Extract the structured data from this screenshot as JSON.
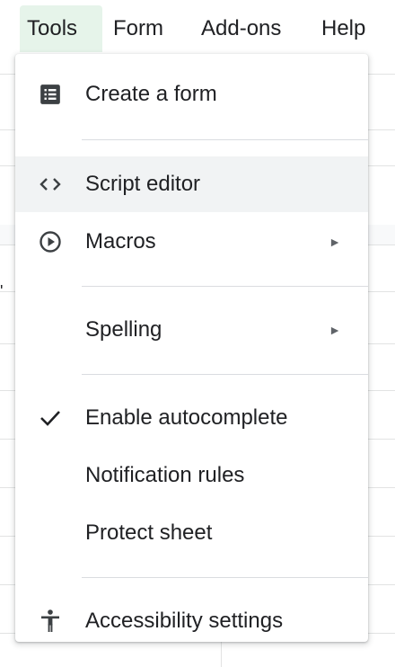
{
  "menubar": {
    "tabs": [
      {
        "label": "Tools",
        "active": true
      },
      {
        "label": "Form"
      },
      {
        "label": "Add-ons"
      },
      {
        "label": "Help"
      }
    ]
  },
  "sheet": {
    "left_edge_glyph": "'"
  },
  "tools_menu": {
    "items": [
      {
        "label": "Create a form",
        "icon": "form-icon"
      },
      {
        "label": "Script editor",
        "icon": "code-brackets-icon",
        "hovered": true
      },
      {
        "label": "Macros",
        "icon": "play-circle-icon",
        "submenu": true
      },
      {
        "label": "Spelling",
        "submenu": true
      },
      {
        "label": "Enable autocomplete",
        "icon": "checkmark-icon",
        "checked": true
      },
      {
        "label": "Notification rules"
      },
      {
        "label": "Protect sheet"
      },
      {
        "label": "Accessibility settings",
        "icon": "accessibility-icon"
      }
    ],
    "submenu_arrow": "►"
  },
  "colors": {
    "active_tab_bg": "#e6f4ea",
    "hover_bg": "#f1f3f4",
    "separator": "#dadce0",
    "text": "#202124"
  }
}
